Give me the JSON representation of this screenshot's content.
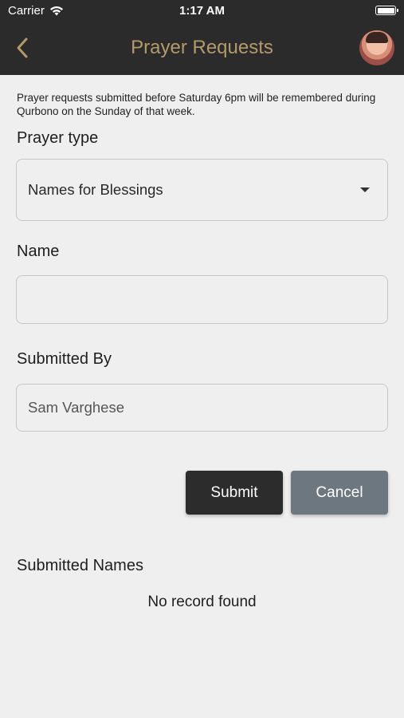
{
  "status_bar": {
    "carrier": "Carrier",
    "time": "1:17 AM"
  },
  "nav": {
    "title": "Prayer Requests",
    "back_icon": "chevron-left-icon",
    "avatar": "user-avatar"
  },
  "notice": "Prayer requests submitted before Saturday 6pm will be remembered during Qurbono on the Sunday of that week.",
  "form": {
    "prayer_type_label": "Prayer type",
    "prayer_type_value": "Names for Blessings",
    "name_label": "Name",
    "name_value": "",
    "submitted_by_label": "Submitted By",
    "submitted_by_value": "Sam Varghese"
  },
  "buttons": {
    "submit": "Submit",
    "cancel": "Cancel"
  },
  "submitted": {
    "title": "Submitted Names",
    "empty_text": "No record found"
  },
  "colors": {
    "nav_bg": "#2b2b2b",
    "title_gold": "#b49a6a",
    "submit_bg": "#2c2c2c",
    "cancel_bg": "#6d7780",
    "page_bg": "#efefef"
  }
}
